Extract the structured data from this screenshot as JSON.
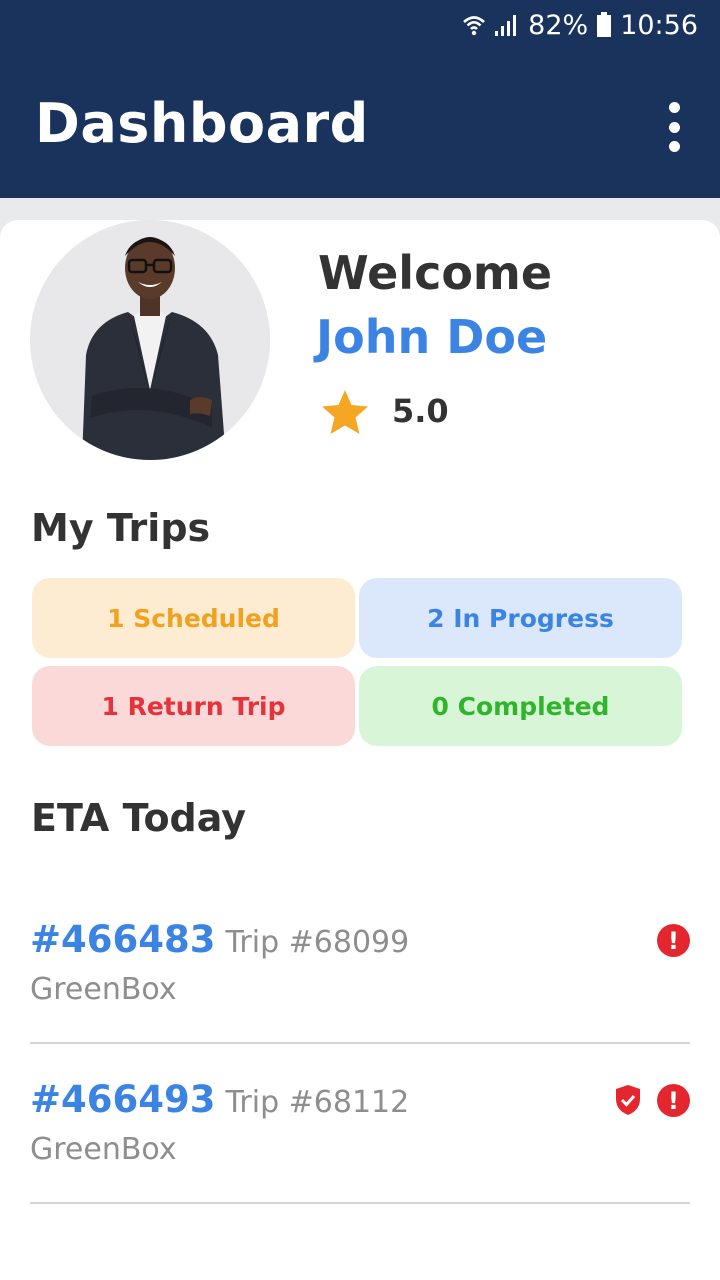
{
  "status_bar": {
    "battery_percent": "82%",
    "time": "10:56",
    "icons": [
      "wifi-icon",
      "signal-icon",
      "battery-icon"
    ]
  },
  "app_bar": {
    "title": "Dashboard",
    "menu_icon": "more-vert-icon"
  },
  "profile": {
    "welcome_text": "Welcome",
    "name": "John Doe",
    "rating": "5.0",
    "rating_icon": "star-icon"
  },
  "trips": {
    "title": "My Trips",
    "items": [
      {
        "label": "1 Scheduled",
        "bg": "#fdebd2",
        "color": "#f0a21f"
      },
      {
        "label": "2 In Progress",
        "bg": "#dbe8fb",
        "color": "#3b84e4"
      },
      {
        "label": "1 Return Trip",
        "bg": "#fbd9d9",
        "color": "#e3333b"
      },
      {
        "label": "0 Completed",
        "bg": "#d9f5d7",
        "color": "#2fb52b"
      }
    ]
  },
  "eta": {
    "title": "ETA Today",
    "rows": [
      {
        "id": "#466483",
        "trip": "Trip #68099",
        "company": "GreenBox",
        "icons": [
          "alert-icon"
        ]
      },
      {
        "id": "#466493",
        "trip": "Trip #68112",
        "company": "GreenBox",
        "icons": [
          "shield-check-icon",
          "alert-icon"
        ]
      }
    ]
  },
  "colors": {
    "header": "#1a335d",
    "accent": "#3b84e4",
    "star": "#f5a623",
    "alert": "#e4262e"
  }
}
